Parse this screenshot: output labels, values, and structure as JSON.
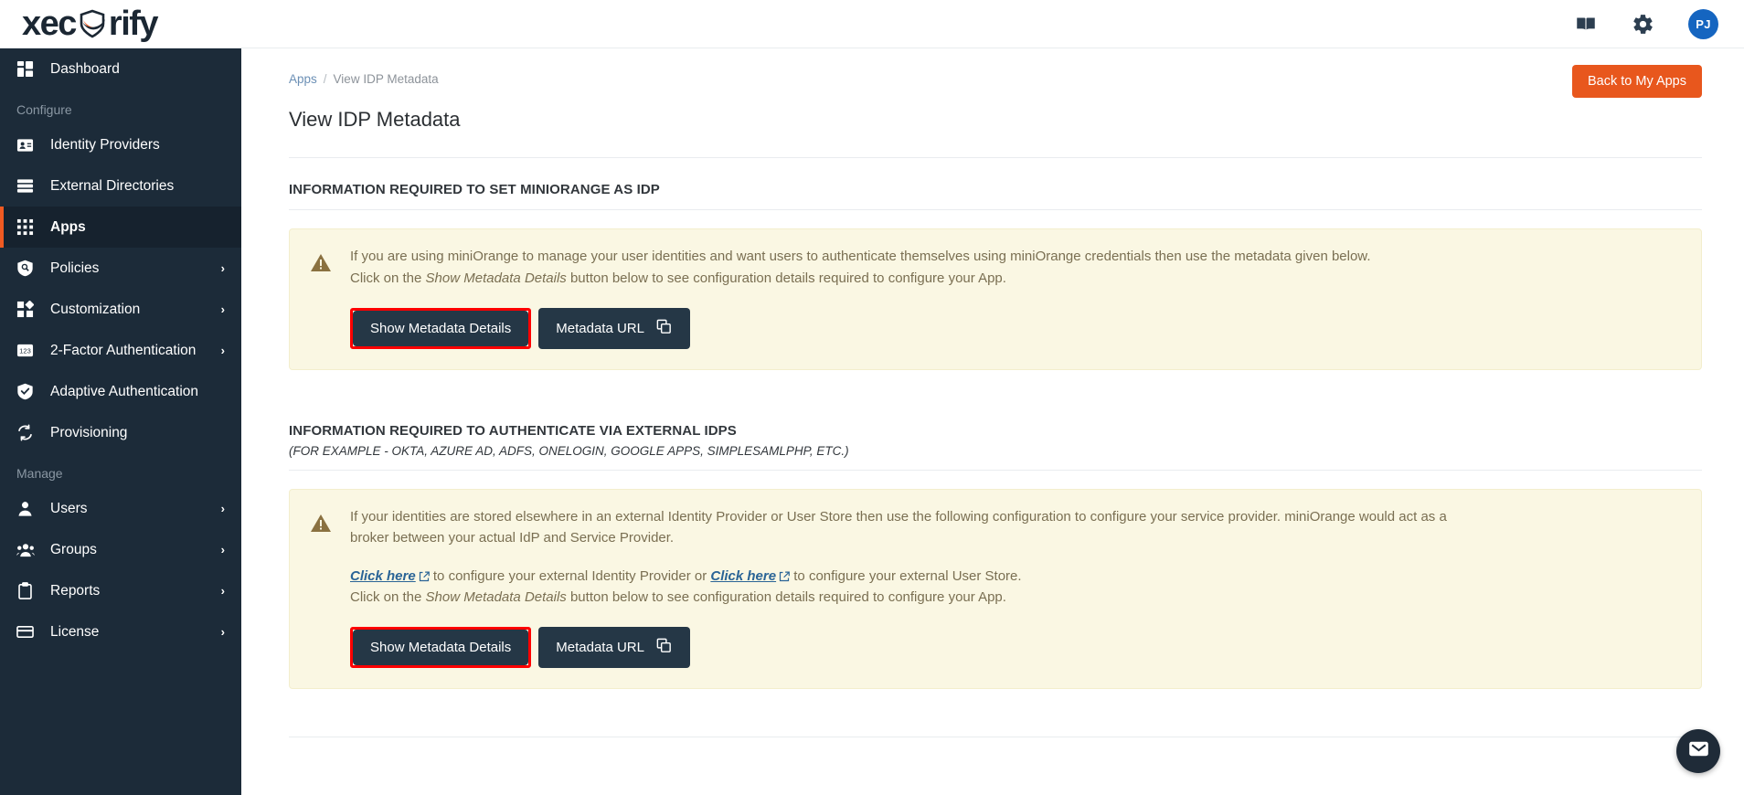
{
  "header": {
    "logo_text_1": "xec",
    "logo_text_2": "rify",
    "book_icon": "book-icon",
    "gear_icon": "gear-icon",
    "avatar_initials": "PJ",
    "avatar_color": "#1565c0"
  },
  "sidebar": {
    "items": [
      {
        "label": "Dashboard",
        "icon": "dashboard-icon",
        "chevron": "",
        "active": false,
        "type": "item"
      },
      {
        "label": "Configure",
        "type": "section"
      },
      {
        "label": "Identity Providers",
        "icon": "id-card-icon",
        "chevron": "",
        "active": false,
        "type": "item"
      },
      {
        "label": "External Directories",
        "icon": "list-icon",
        "chevron": "",
        "active": false,
        "type": "item"
      },
      {
        "label": "Apps",
        "icon": "grid-icon",
        "chevron": "",
        "active": true,
        "type": "item"
      },
      {
        "label": "Policies",
        "icon": "shield-search-icon",
        "chevron": "›",
        "active": false,
        "type": "item"
      },
      {
        "label": "Customization",
        "icon": "puzzle-icon",
        "chevron": "›",
        "active": false,
        "type": "item"
      },
      {
        "label": "2-Factor Authentication",
        "icon": "numpad-icon",
        "chevron": "›",
        "active": false,
        "type": "item"
      },
      {
        "label": "Adaptive Authentication",
        "icon": "shield-check-icon",
        "chevron": "",
        "active": false,
        "type": "item"
      },
      {
        "label": "Provisioning",
        "icon": "sync-icon",
        "chevron": "",
        "active": false,
        "type": "item"
      },
      {
        "label": "Manage",
        "type": "section"
      },
      {
        "label": "Users",
        "icon": "user-icon",
        "chevron": "›",
        "active": false,
        "type": "item"
      },
      {
        "label": "Groups",
        "icon": "users-icon",
        "chevron": "›",
        "active": false,
        "type": "item"
      },
      {
        "label": "Reports",
        "icon": "clipboard-icon",
        "chevron": "›",
        "active": false,
        "type": "item"
      },
      {
        "label": "License",
        "icon": "card-icon",
        "chevron": "›",
        "active": false,
        "type": "item"
      }
    ]
  },
  "main": {
    "breadcrumb": {
      "parent": "Apps",
      "separator": "/",
      "current": "View IDP Metadata"
    },
    "page_title": "View IDP Metadata",
    "back_button": "Back to My Apps",
    "back_button_color": "#e8571d",
    "section1": {
      "title": "INFORMATION REQUIRED TO SET MINIORANGE AS IDP",
      "alert_line1": "If you are using miniOrange to manage your user identities and want users to authenticate themselves using miniOrange credentials then use the metadata given below.",
      "alert_line2_pre": "Click on the ",
      "alert_line2_em": "Show Metadata Details",
      "alert_line2_post": " button below to see configuration details required to configure your App.",
      "btn_primary": "Show Metadata Details",
      "btn_secondary": "Metadata URL",
      "copy_icon": "copy-icon",
      "warning_icon": "warning-triangle-icon",
      "highlight_color": "#ff0000"
    },
    "section2": {
      "title": "INFORMATION REQUIRED TO AUTHENTICATE VIA EXTERNAL IDPS",
      "subtitle": "(FOR EXAMPLE - OKTA, AZURE AD, ADFS, ONELOGIN, GOOGLE APPS, SIMPLESAMLPHP, ETC.)",
      "alert_line1": "If your identities are stored elsewhere in an external Identity Provider or User Store then use the following configuration to configure your service provider. miniOrange would act as a",
      "alert_line2": "broker between your actual IdP and Service Provider.",
      "link1": "Click here",
      "link1_after": " to configure your external Identity Provider or ",
      "link2": "Click here",
      "link2_after": " to configure your external User Store.",
      "alert_line4_pre": "Click on the ",
      "alert_line4_em": "Show Metadata Details",
      "alert_line4_post": " button below to see configuration details required to configure your App.",
      "btn_primary": "Show Metadata Details",
      "btn_secondary": "Metadata URL",
      "copy_icon": "copy-icon",
      "warning_icon": "warning-triangle-icon"
    }
  },
  "chat_widget": {
    "icon": "envelope-icon"
  }
}
